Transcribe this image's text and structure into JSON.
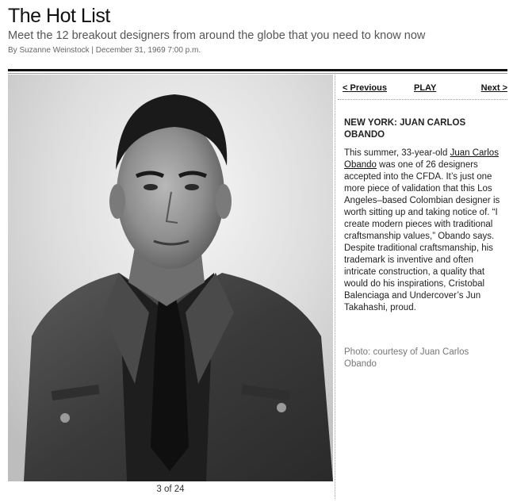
{
  "header": {
    "title": "The Hot List",
    "subtitle": "Meet the 12 breakout designers from around the globe that you need to know now",
    "byline": "By Suzanne Weinstock | December 31, 1969 7:00 p.m."
  },
  "slideshow": {
    "counter": "3 of 24",
    "nav": {
      "previous": "< Previous",
      "play": "PLAY",
      "next": "Next >"
    },
    "photo_icon": "portrait-photo"
  },
  "caption": {
    "heading": "NEW YORK: JUAN CARLOS OBANDO",
    "text_before_link": "This summer, 33-year-old ",
    "link": "Juan Carlos Obando",
    "text_after_link": " was one of 26 designers accepted into the CFDA. It’s just one more piece of validation that this Los Angeles–based Colombian designer is worth sitting up and taking notice of. “I create modern pieces with traditional craftsmanship values,” Obando says. Despite traditional craftsmanship, his trademark is inventive and often intricate construction, a quality that would do his inspirations, Cristobal Balenciaga and Undercover’s Jun Takahashi, proud.",
    "credit": "Photo: courtesy of Juan Carlos Obando"
  },
  "colors": {
    "rule": "#111111",
    "text": "#222222",
    "muted": "#777777"
  }
}
